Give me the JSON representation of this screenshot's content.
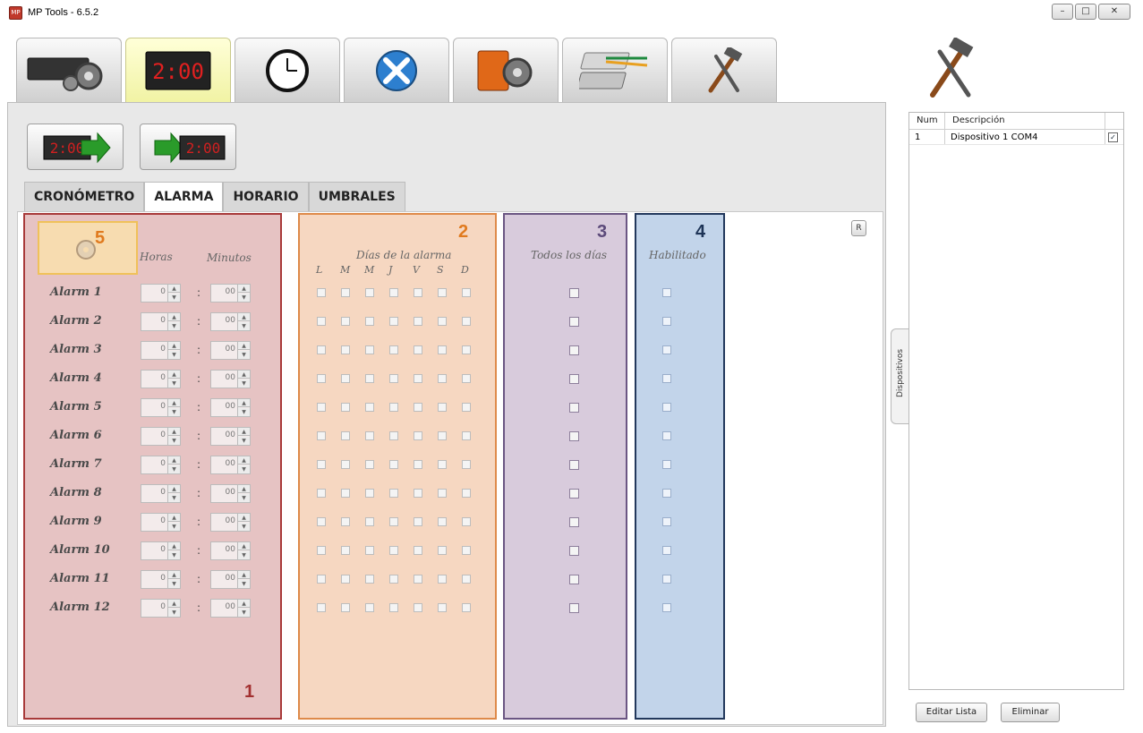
{
  "window": {
    "title": "MP Tools - 6.5.2",
    "app_icon_text": "MP",
    "controls": [
      "–",
      "□",
      "✕"
    ]
  },
  "toolbar": {
    "tabs": [
      {
        "name": "device-config",
        "icon": "gear-display-icon",
        "active": false
      },
      {
        "name": "red-led-display",
        "icon": "led-display-icon",
        "active": true
      },
      {
        "name": "clock",
        "icon": "clock-icon",
        "active": false
      },
      {
        "name": "tools",
        "icon": "wrench-screwdriver-icon",
        "active": false
      },
      {
        "name": "mp-tools",
        "icon": "mp-logo-gear-icon",
        "active": false
      },
      {
        "name": "network",
        "icon": "network-cable-icon",
        "active": false
      },
      {
        "name": "hammer",
        "icon": "hammer-wrench-icon",
        "active": false
      }
    ],
    "led_text": "2:00"
  },
  "panel": {
    "tool_buttons": [
      {
        "name": "send-to-display",
        "icon": "led-arrow-right-icon",
        "led_text": "2:00"
      },
      {
        "name": "receive-from-display",
        "icon": "arrow-led-icon",
        "led_text": "2:00"
      }
    ],
    "subtabs": [
      "CRONÓMETRO",
      "ALARMA",
      "HORARIO",
      "UMBRALES"
    ],
    "active_subtab": "ALARMA",
    "reset_button": "R",
    "zones": {
      "z1": "1",
      "z2": "2",
      "z3": "3",
      "z4": "4",
      "z5": "5"
    },
    "headers": {
      "horas": "Horas",
      "minutos": "Minutos",
      "dias": "Días de la alarma",
      "todos": "Todos los días",
      "habilitado": "Habilitado",
      "days": [
        "L",
        "M",
        "M",
        "J",
        "V",
        "S",
        "D"
      ]
    },
    "colon": ":",
    "alarms": [
      {
        "label": "Alarm 1",
        "hours": "0",
        "minutes": "00"
      },
      {
        "label": "Alarm 2",
        "hours": "0",
        "minutes": "00"
      },
      {
        "label": "Alarm 3",
        "hours": "0",
        "minutes": "00"
      },
      {
        "label": "Alarm 4",
        "hours": "0",
        "minutes": "00"
      },
      {
        "label": "Alarm 5",
        "hours": "0",
        "minutes": "00"
      },
      {
        "label": "Alarm 6",
        "hours": "0",
        "minutes": "00"
      },
      {
        "label": "Alarm 7",
        "hours": "0",
        "minutes": "00"
      },
      {
        "label": "Alarm 8",
        "hours": "0",
        "minutes": "00"
      },
      {
        "label": "Alarm 9",
        "hours": "0",
        "minutes": "00"
      },
      {
        "label": "Alarm 10",
        "hours": "0",
        "minutes": "00"
      },
      {
        "label": "Alarm 11",
        "hours": "0",
        "minutes": "00"
      },
      {
        "label": "Alarm 12",
        "hours": "0",
        "minutes": "00"
      }
    ],
    "colors": {
      "zone1": "#e6c3c3",
      "zone2": "#f6d7c1",
      "zone3": "#d8cbdc",
      "zone4": "#c2d4ea",
      "zone5": "#f7dcb0"
    }
  },
  "sidebar": {
    "icon": "hammer-wrench-icon",
    "tab_label": "Dispositivos",
    "columns": [
      "Num",
      "Descripción"
    ],
    "devices": [
      {
        "num": "1",
        "desc": "Dispositivo 1 COM4",
        "checked": true
      }
    ],
    "check_mark": "✓",
    "buttons": [
      "Editar Lista",
      "Eliminar"
    ]
  }
}
